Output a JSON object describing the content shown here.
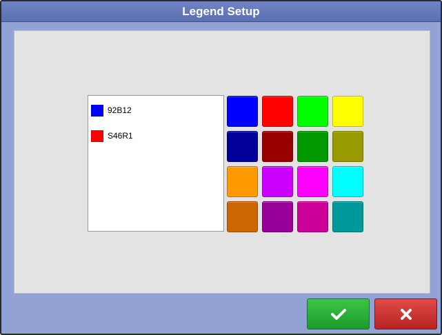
{
  "dialog": {
    "title": "Legend Setup"
  },
  "legend": {
    "items": [
      {
        "label": "92B12",
        "color": "#0000ff"
      },
      {
        "label": "S46R1",
        "color": "#ff0000"
      }
    ]
  },
  "palette": {
    "colors": [
      "#0000ff",
      "#ff0000",
      "#00ff00",
      "#ffff00",
      "#000099",
      "#990000",
      "#009900",
      "#999900",
      "#ff9900",
      "#cc00ff",
      "#ff00ff",
      "#00ffff",
      "#cc6600",
      "#990099",
      "#cc0099",
      "#009999"
    ]
  },
  "buttons": {
    "ok": {
      "icon": "checkmark-icon",
      "color": "#22a82f"
    },
    "cancel": {
      "icon": "close-icon",
      "color": "#c8302c"
    }
  }
}
